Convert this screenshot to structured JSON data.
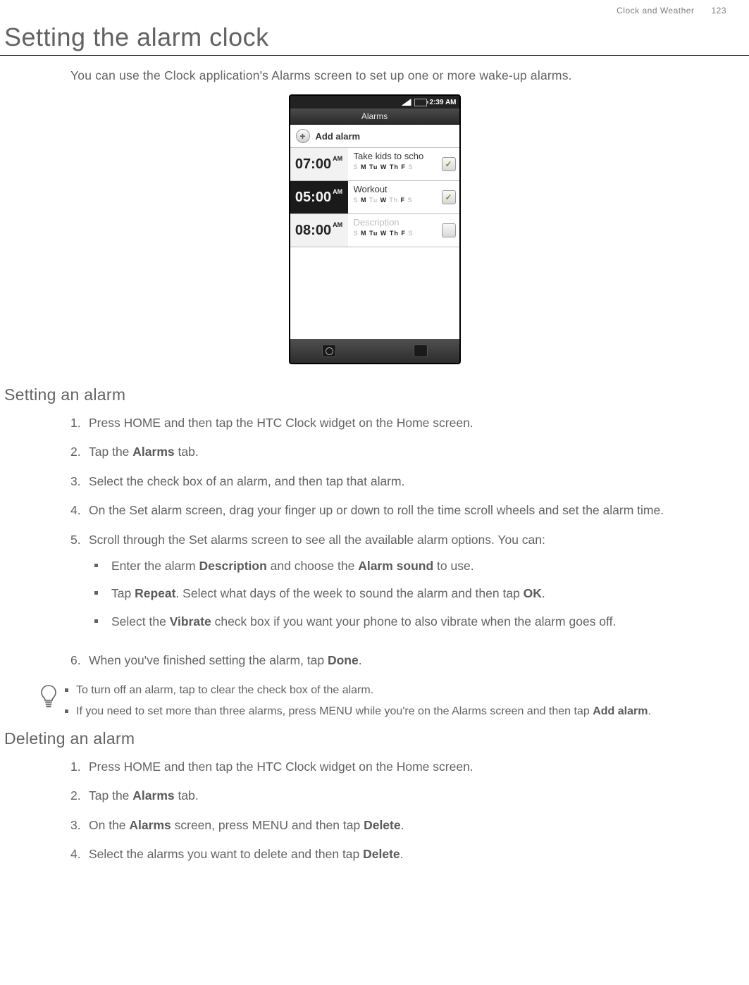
{
  "header": {
    "breadcrumb": "Clock and Weather",
    "page": "123"
  },
  "title": "Setting the alarm clock",
  "intro": "You can use the Clock application's Alarms screen to set up one or more wake-up alarms.",
  "phone": {
    "status_time": "2:39 AM",
    "screen_title": "Alarms",
    "add_label": "Add alarm",
    "rows": [
      {
        "time": "07:00",
        "ampm": "AM",
        "desc": "Take kids to scho",
        "active": true,
        "checked": true,
        "days": [
          [
            "S",
            false
          ],
          [
            "M",
            true
          ],
          [
            "Tu",
            true
          ],
          [
            "W",
            true
          ],
          [
            "Th",
            true
          ],
          [
            "F",
            true
          ],
          [
            "S",
            false
          ]
        ]
      },
      {
        "time": "05:00",
        "ampm": "AM",
        "desc": "Workout",
        "active": true,
        "checked": true,
        "days": [
          [
            "S",
            false
          ],
          [
            "M",
            true
          ],
          [
            "Tu",
            false
          ],
          [
            "W",
            true
          ],
          [
            "Th",
            false
          ],
          [
            "F",
            true
          ],
          [
            "S",
            false
          ]
        ]
      },
      {
        "time": "08:00",
        "ampm": "AM",
        "desc": "Description",
        "active": false,
        "checked": false,
        "days": [
          [
            "S",
            false
          ],
          [
            "M",
            true
          ],
          [
            "Tu",
            true
          ],
          [
            "W",
            true
          ],
          [
            "Th",
            true
          ],
          [
            "F",
            true
          ],
          [
            "S",
            false
          ]
        ]
      }
    ]
  },
  "setting": {
    "heading": "Setting an alarm",
    "steps": {
      "s1": "Press HOME and then tap the HTC Clock widget on the Home screen.",
      "s2a": "Tap the ",
      "s2b": "Alarms",
      "s2c": " tab.",
      "s3": "Select the check box of an alarm, and then tap that alarm.",
      "s4": "On the Set alarm screen, drag your finger up or down to roll the time scroll wheels and set the alarm time.",
      "s5": "Scroll through the Set alarms screen to see all the available alarm options. You can:",
      "b1a": "Enter the alarm ",
      "b1b": "Description",
      "b1c": " and choose the ",
      "b1d": "Alarm sound",
      "b1e": " to use.",
      "b2a": "Tap ",
      "b2b": "Repeat",
      "b2c": ". Select what days of the week to sound the alarm and then tap ",
      "b2d": "OK",
      "b2e": ".",
      "b3a": "Select the ",
      "b3b": "Vibrate",
      "b3c": " check box if you want your phone to also vibrate when the alarm goes off.",
      "s6a": "When you've finished setting the alarm, tap ",
      "s6b": "Done",
      "s6c": "."
    },
    "tips": {
      "t1": "To turn off an alarm, tap to clear the check box of the alarm.",
      "t2a": "If you need to set more than three alarms, press MENU while you're on the Alarms screen and then tap ",
      "t2b": "Add alarm",
      "t2c": "."
    }
  },
  "deleting": {
    "heading": "Deleting an alarm",
    "steps": {
      "s1": "Press HOME and then tap the HTC Clock widget on the Home screen.",
      "s2a": "Tap the ",
      "s2b": "Alarms",
      "s2c": " tab.",
      "s3a": "On the ",
      "s3b": "Alarms",
      "s3c": " screen, press MENU and then tap ",
      "s3d": "Delete",
      "s3e": ".",
      "s4a": "Select the alarms you want to delete and then tap ",
      "s4b": "Delete",
      "s4c": "."
    }
  }
}
